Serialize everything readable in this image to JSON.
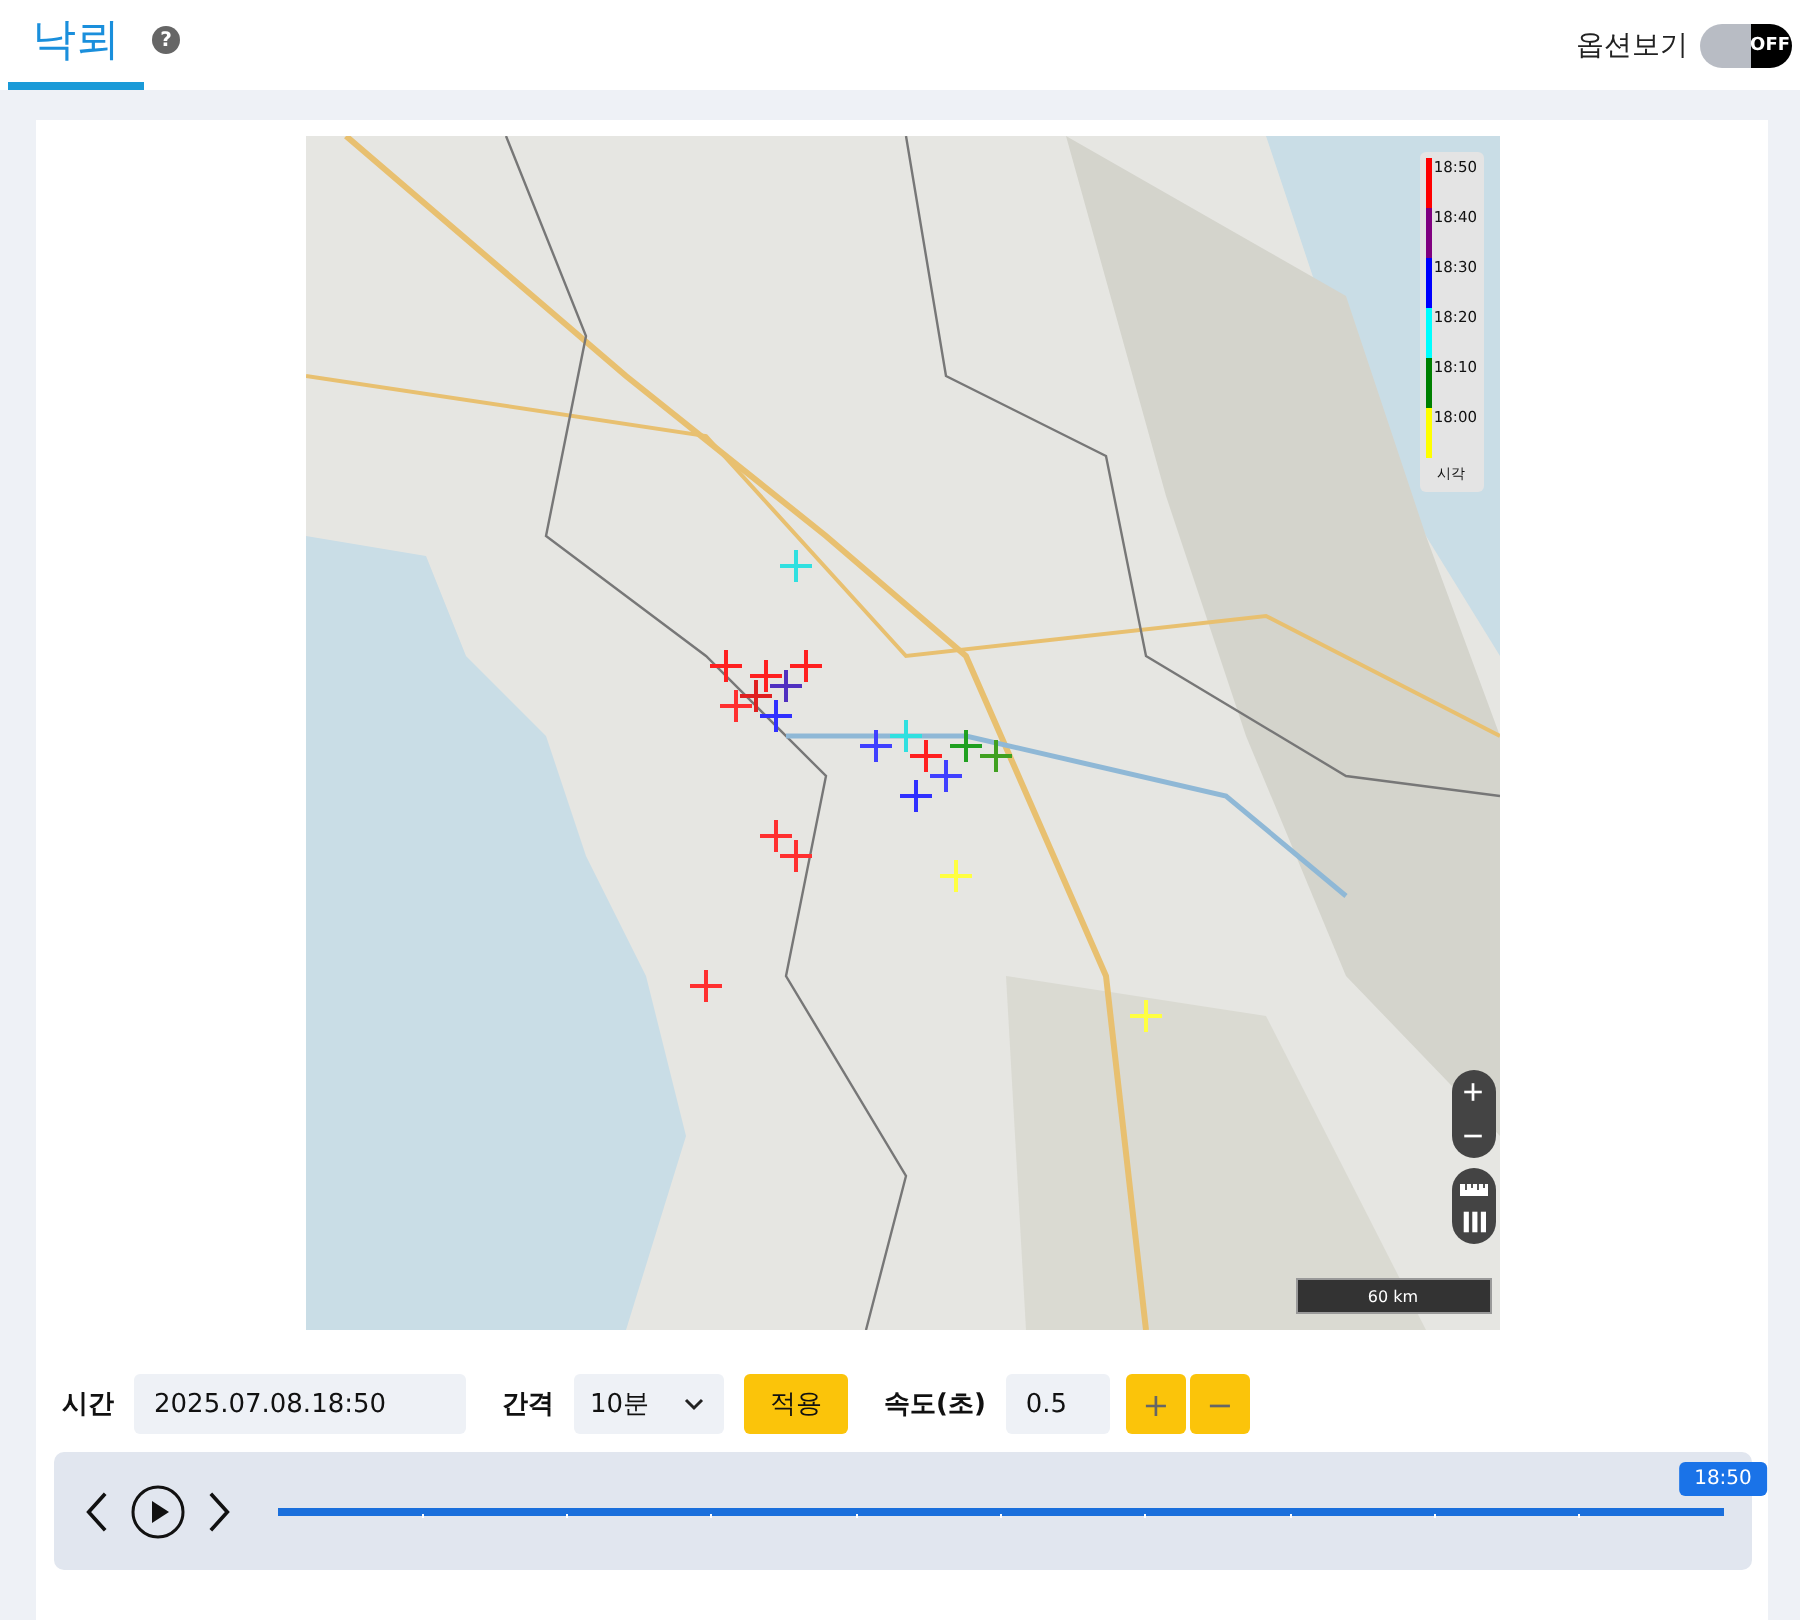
{
  "header": {
    "tab": {
      "label": "낙뢰",
      "selected": true
    },
    "help": "?",
    "option_toggle": {
      "label": "옵션보기",
      "on": false,
      "state_text": "OFF"
    }
  },
  "map": {
    "legend": {
      "items": [
        {
          "label": "18:50",
          "color": "#ff0000"
        },
        {
          "label": "18:40",
          "color": "#800080"
        },
        {
          "label": "18:30",
          "color": "#0000ff"
        },
        {
          "label": "18:20",
          "color": "#00ffff"
        },
        {
          "label": "18:10",
          "color": "#008000"
        },
        {
          "label": "18:00",
          "color": "#ffff00"
        }
      ],
      "caption": "시각"
    },
    "zoom_in": "+",
    "zoom_out": "−",
    "scale": "60 km"
  },
  "controls": {
    "time": {
      "label": "시간",
      "value": "2025.07.08.18:50"
    },
    "interval": {
      "label": "간격",
      "value": "10분"
    },
    "apply": "적용",
    "speed": {
      "label": "속도(초)",
      "value": "0.5",
      "plus": "+",
      "minus": "−"
    }
  },
  "timeline": {
    "level": 1,
    "tooltip": "18:50"
  }
}
